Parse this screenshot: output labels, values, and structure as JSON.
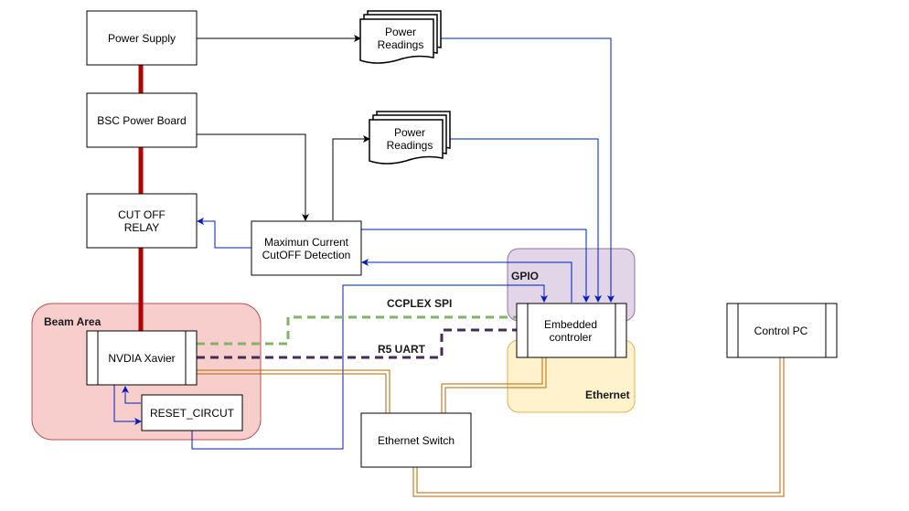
{
  "diagram": {
    "groups": {
      "beam_area": "Beam Area",
      "gpio": "GPIO",
      "ethernet": "Ethernet"
    },
    "nodes": {
      "power_supply": "Power Supply",
      "bsc_power_board": "BSC Power Board",
      "cut_off_relay": [
        "CUT OFF",
        "RELAY"
      ],
      "max_current": [
        "Maximun Current",
        "CutOFF Detection"
      ],
      "power_readings_1": [
        "Power",
        "Readings"
      ],
      "power_readings_2": [
        "Power",
        "Readings"
      ],
      "nvidia_xavier": "NVDIA Xavier",
      "reset_circuit": "RESET_CIRCUT",
      "embedded_controller": [
        "Embedded",
        "controler"
      ],
      "ethernet_switch": "Ethernet Switch",
      "control_pc": "Control PC"
    },
    "edge_labels": {
      "ccplex_spi": "CCPLEX SPI",
      "r5_uart": "R5 UART"
    },
    "colors": {
      "power_line": "#b20000",
      "signal_line": "#001dbc",
      "control_arrow": "#000000",
      "spi_line": "#82b366",
      "uart_line": "#432d57",
      "ethernet_line": "#b46504",
      "beam_area_fill": "#f8cecc",
      "beam_area_stroke": "#b85450",
      "gpio_fill": "#e1d5e7",
      "gpio_stroke": "#9673a6",
      "ethernet_fill": "#fff2cc",
      "ethernet_stroke": "#d6b656"
    }
  }
}
